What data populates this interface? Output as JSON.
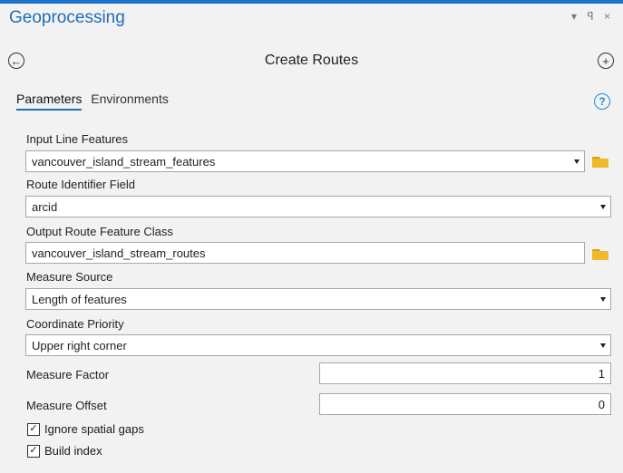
{
  "pane": {
    "title": "Geoprocessing",
    "ctrl_dropdown": "▾",
    "ctrl_pin": "ꟼ",
    "ctrl_close": "×"
  },
  "tool": {
    "title": "Create Routes",
    "back_glyph": "←",
    "add_glyph": "+"
  },
  "tabs": [
    {
      "label": "Parameters",
      "active": true
    },
    {
      "label": "Environments",
      "active": false
    }
  ],
  "help_glyph": "?",
  "params": {
    "input_line_features": {
      "label": "Input Line Features",
      "value": "vancouver_island_stream_features"
    },
    "route_identifier_field": {
      "label": "Route Identifier Field",
      "value": "arcid"
    },
    "output_route_feature_class": {
      "label": "Output Route Feature Class",
      "value": "vancouver_island_stream_routes"
    },
    "measure_source": {
      "label": "Measure Source",
      "value": "Length of features"
    },
    "coordinate_priority": {
      "label": "Coordinate Priority",
      "value": "Upper right corner"
    },
    "measure_factor": {
      "label": "Measure Factor",
      "value": "1"
    },
    "measure_offset": {
      "label": "Measure Offset",
      "value": "0"
    },
    "ignore_spatial_gaps": {
      "label": "Ignore spatial gaps",
      "checked": true,
      "mark": "✓"
    },
    "build_index": {
      "label": "Build index",
      "checked": true,
      "mark": "✓"
    }
  },
  "colors": {
    "accent": "#1d6fb7",
    "title_bar": "#1a73c8",
    "folder": "#f0b82b"
  }
}
